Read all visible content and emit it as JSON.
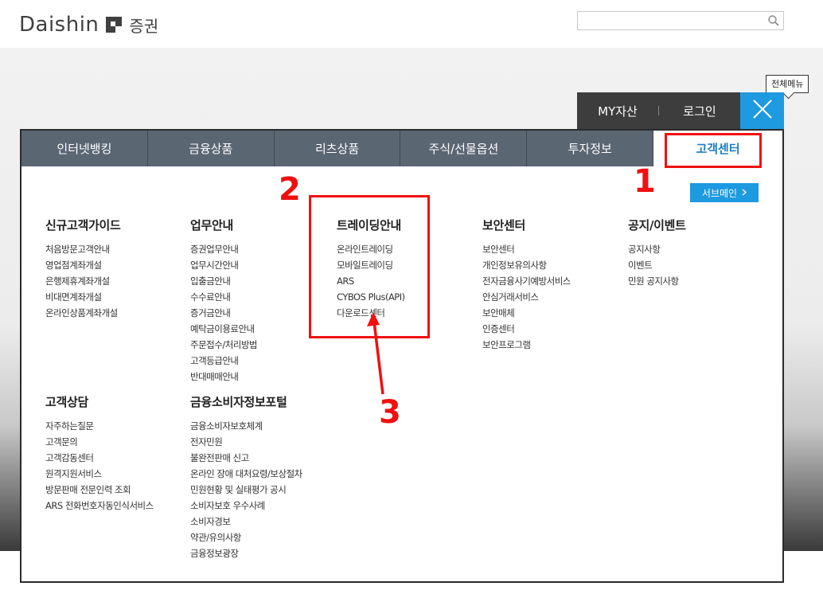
{
  "header": {
    "logo_text": "Daishin",
    "logo_suffix": "증권",
    "search_placeholder": "",
    "all_menu_tooltip": "전체메뉴"
  },
  "user_bar": {
    "my_assets": "MY자산",
    "login": "로그인"
  },
  "nav": {
    "tabs": [
      {
        "label": "인터넷뱅킹"
      },
      {
        "label": "금융상품"
      },
      {
        "label": "리츠상품"
      },
      {
        "label": "주식/선물옵션"
      },
      {
        "label": "투자정보"
      },
      {
        "label": "고객센터"
      }
    ]
  },
  "submain_label": "서브메인",
  "columns": {
    "newcustomer": {
      "title": "신규고객가이드",
      "items": [
        "처음방문고객안내",
        "영업점계좌개설",
        "은행제휴계좌개설",
        "비대면계좌개설",
        "온라인상품계좌개설"
      ]
    },
    "business": {
      "title": "업무안내",
      "items": [
        "증권업무안내",
        "업무시간안내",
        "입출금안내",
        "수수료안내",
        "증거금안내",
        "예탁금이용료안내",
        "주문접수/처리방법",
        "고객등급안내",
        "반대매매안내"
      ]
    },
    "trading": {
      "title": "트레이딩안내",
      "items": [
        "온라인트레이딩",
        "모바일트레이딩",
        "ARS",
        "CYBOS Plus(API)",
        "다운로드센터"
      ]
    },
    "security": {
      "title": "보안센터",
      "items": [
        "보안센터",
        "개인정보유의사항",
        "전자금융사기예방서비스",
        "안심거래서비스",
        "보안매체",
        "인증센터",
        "보안프로그램"
      ]
    },
    "notice": {
      "title": "공지/이벤트",
      "items": [
        "공지사항",
        "이벤트",
        "민원 공지사항"
      ]
    },
    "consult": {
      "title": "고객상담",
      "items": [
        "자주하는질문",
        "고객문의",
        "고객감동센터",
        "원격지원서비스",
        "방문판매 전문인력 조회",
        "ARS 전화번호자동인식서비스"
      ]
    },
    "consumer": {
      "title": "금융소비자정보포털",
      "items": [
        "금융소비자보호체계",
        "전자민원",
        "불완전판매 신고",
        "온라인 장애 대처요령/보상절차",
        "민원현황 및 실태평가 공시",
        "소비자보호 우수사례",
        "소비자경보",
        "약관/유의사항",
        "금융정보광장"
      ]
    }
  },
  "annotations": {
    "n1": "1",
    "n2": "2",
    "n3": "3"
  },
  "colors": {
    "accent": "#1e9ae0",
    "nav_bg": "#5b6673",
    "annotation": "#f01010"
  }
}
